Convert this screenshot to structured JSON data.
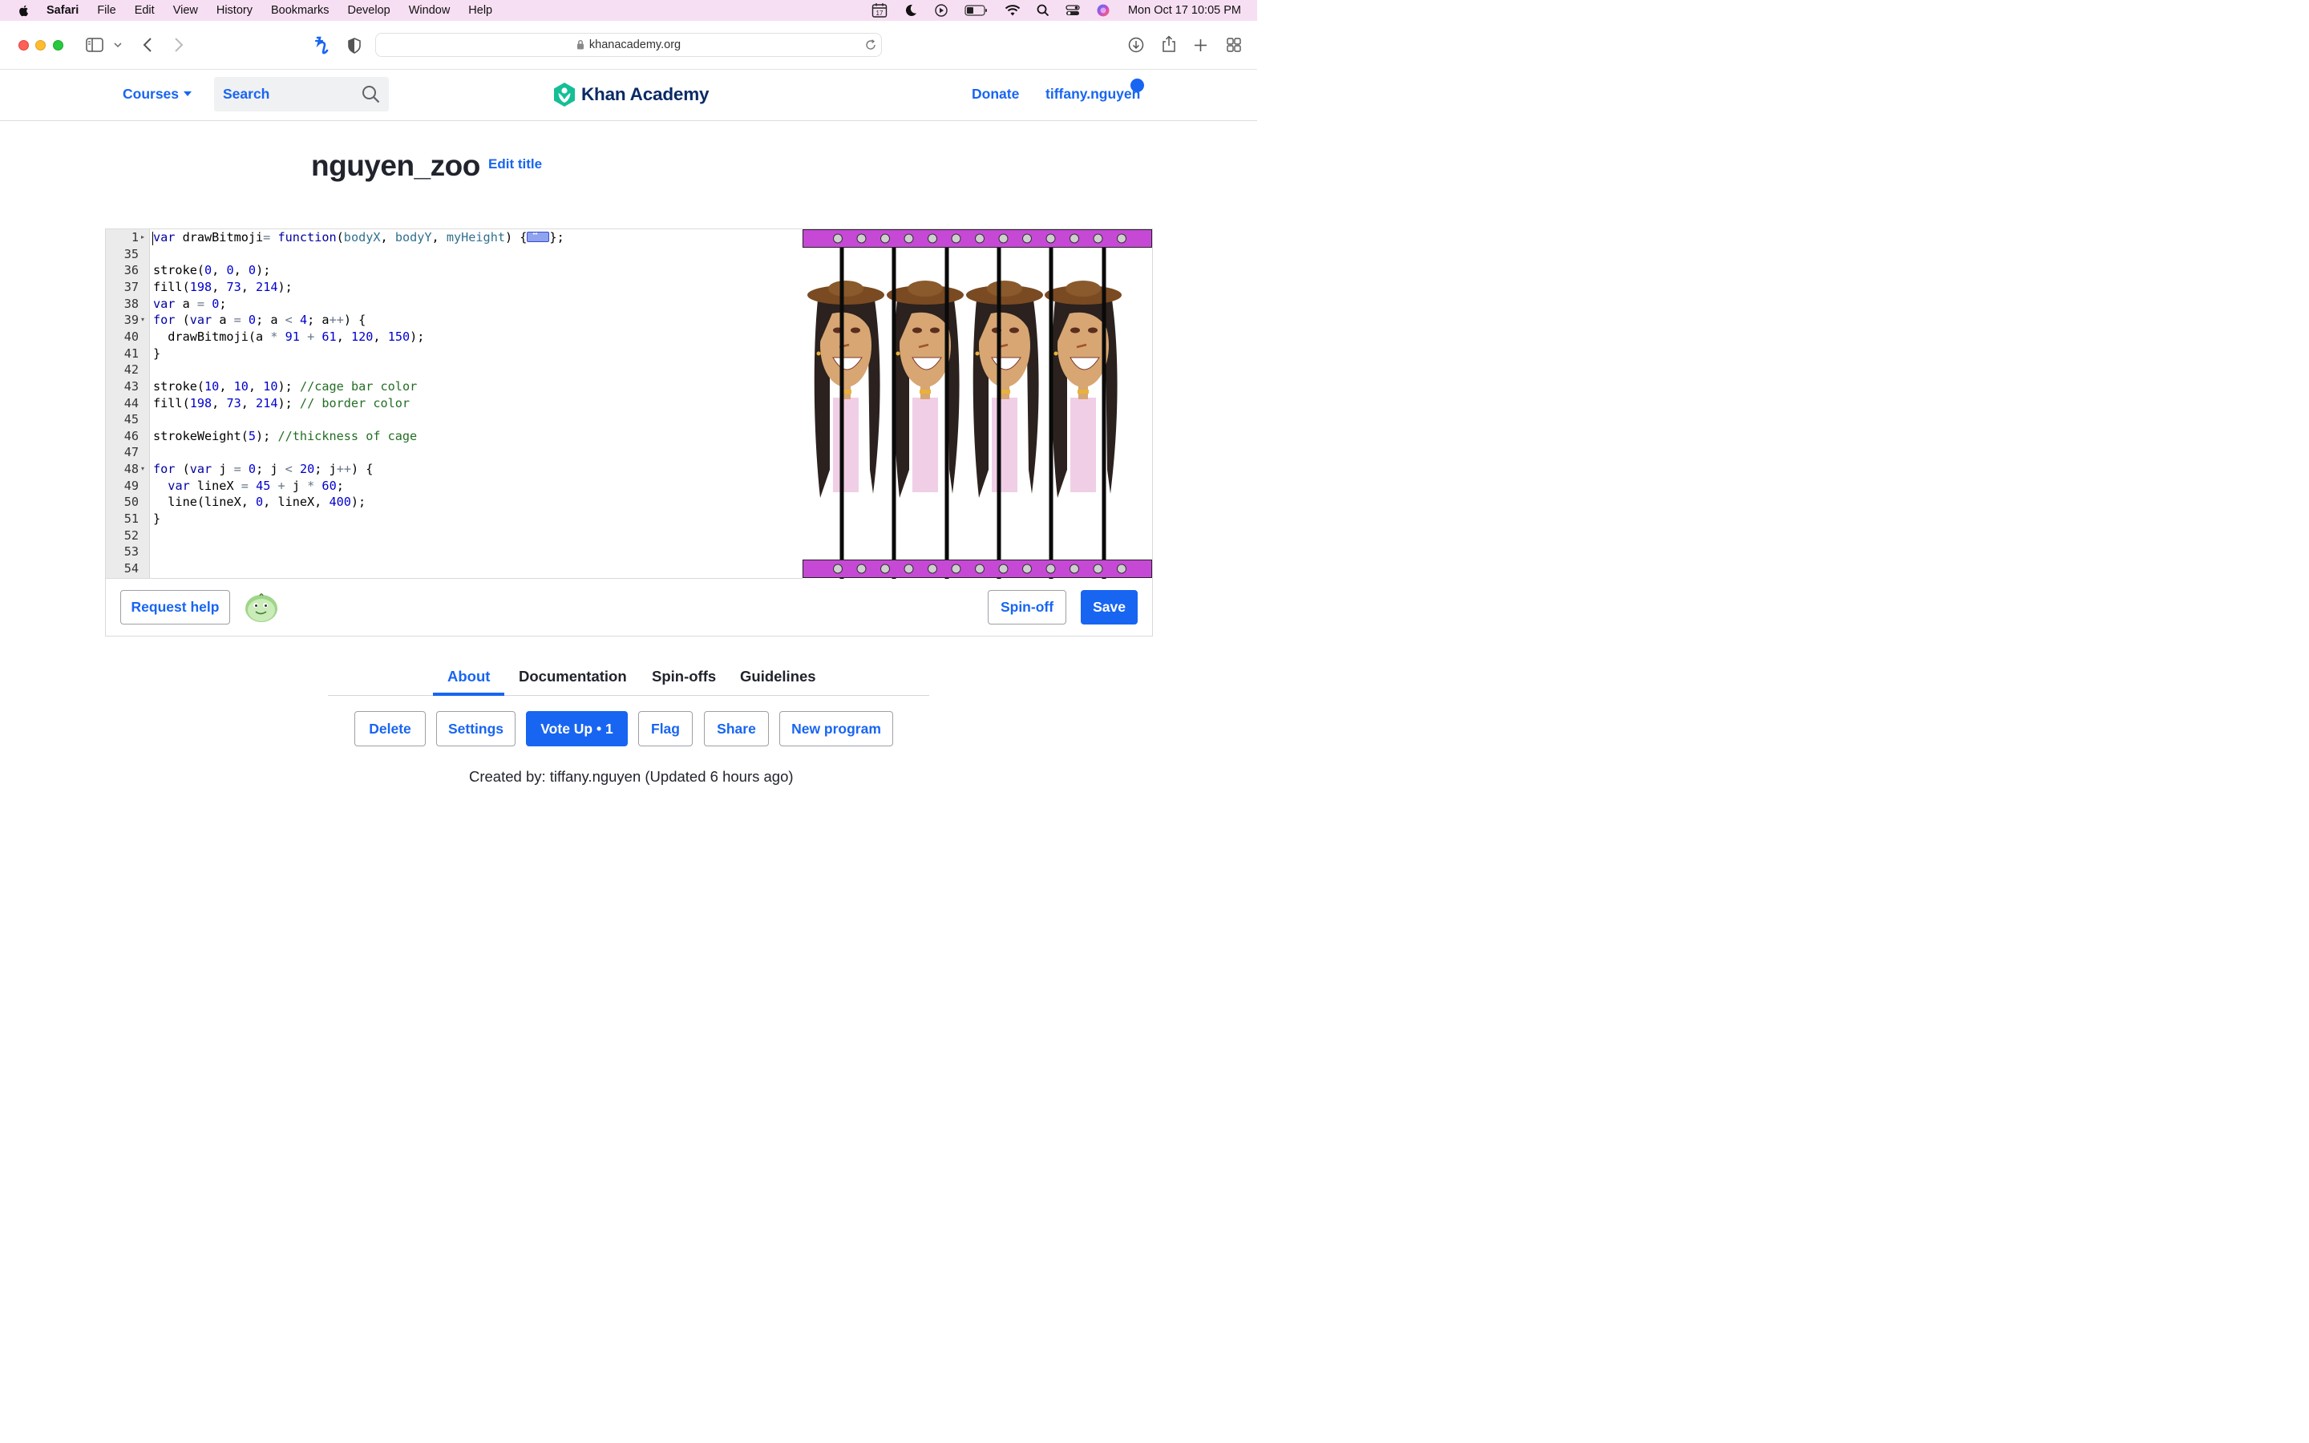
{
  "menubar": {
    "app": "Safari",
    "items": [
      "File",
      "Edit",
      "View",
      "History",
      "Bookmarks",
      "Develop",
      "Window",
      "Help"
    ],
    "calendar_day": "17",
    "datetime": "Mon Oct 17  10:05 PM"
  },
  "browser": {
    "url": "khanacademy.org"
  },
  "header": {
    "courses": "Courses",
    "search_placeholder": "Search",
    "logo": "Khan Academy",
    "donate": "Donate",
    "username": "tiffany.nguyen"
  },
  "program": {
    "title": "nguyen_zoo",
    "edit_title": "Edit title"
  },
  "editor": {
    "line_numbers": [
      "1",
      "35",
      "36",
      "37",
      "38",
      "39",
      "40",
      "41",
      "42",
      "43",
      "44",
      "45",
      "46",
      "47",
      "48",
      "49",
      "50",
      "51",
      "52",
      "53",
      "54"
    ],
    "lines": [
      "var drawBitmoji= function(bodyX, bodyY, myHeight) {⟷};",
      "",
      "stroke(0, 0, 0);",
      "fill(198, 73, 214);",
      "var a = 0;",
      "for (var a = 0; a < 4; a++) {",
      "  drawBitmoji(a * 91 + 61, 120, 150);",
      "}",
      "",
      "stroke(10, 10, 10); //cage bar color",
      "fill(198, 73, 214); // border color",
      "",
      "strokeWeight(5); //thickness of cage",
      "",
      "for (var j = 0; j < 20; j++) {",
      "  var lineX = 45 + j * 60;",
      "  line(lineX, 0, lineX, 400);",
      "}",
      "",
      "",
      ""
    ]
  },
  "canvas_colors": {
    "border": "#c649d6",
    "bars": "#0a0a0a",
    "hair": "#2b211e",
    "hat": "#7a4a22",
    "skin": "#d7a673",
    "shirt": "#f0cfe6"
  },
  "actions": {
    "request_help": "Request help",
    "spin_off": "Spin-off",
    "save": "Save"
  },
  "tabs": [
    "About",
    "Documentation",
    "Spin-offs",
    "Guidelines"
  ],
  "about_buttons": {
    "delete": "Delete",
    "settings": "Settings",
    "vote_up": "Vote Up • 1",
    "flag": "Flag",
    "share": "Share",
    "new_program": "New program"
  },
  "created_by": "Created by: tiffany.nguyen (Updated 6 hours ago)"
}
